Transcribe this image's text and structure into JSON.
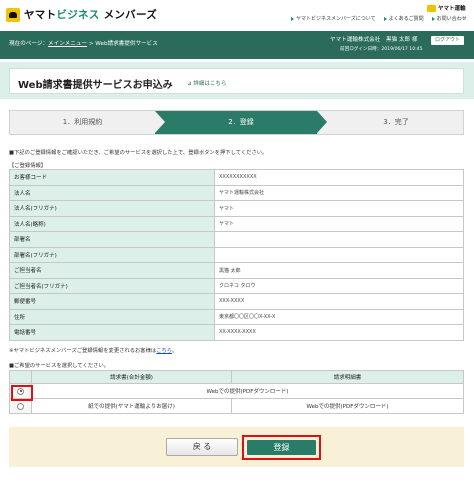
{
  "header": {
    "logo_text_1": "ヤマト",
    "logo_text_accent": "ビジネス",
    "logo_text_2": "メンバーズ",
    "links": [
      {
        "label": "ヤマトビジネスメンバーズについて"
      },
      {
        "label": "よくあるご質問"
      },
      {
        "label": "お問い合わせ"
      }
    ],
    "brand_badge": "ヤマト運輸"
  },
  "nav": {
    "breadcrumb_prefix": "現在のページ：",
    "breadcrumb_link": "メインメニュー",
    "breadcrumb_sep": " > ",
    "breadcrumb_current": "Web請求書提供サービス",
    "company": "ヤマト運輸株式会社",
    "user": "黒猫 太郎 様",
    "last_login": "前回ログイン日時：2019/06/17 10:45",
    "logout_label": "ログアウト"
  },
  "page": {
    "title": "Web請求書提供サービスお申込み",
    "detail_link": "詳細はこちら"
  },
  "steps": [
    {
      "label": "1．利用規約"
    },
    {
      "label": "2．登録"
    },
    {
      "label": "3．完了"
    }
  ],
  "notice": "■下記のご登録情報をご確認いただき、ご希望のサービスを選択した上で、登録ボタンを押下してください。",
  "section_label": "【ご登録情報】",
  "info_rows": [
    {
      "label": "お客様コード",
      "value": "XXXXXXXXXXX"
    },
    {
      "label": "法人名",
      "value": "ヤマト運輸株式会社"
    },
    {
      "label": "法人名(フリガナ)",
      "value": "ヤマト"
    },
    {
      "label": "法人名(略称)",
      "value": "ヤマト"
    },
    {
      "label": "部署名",
      "value": ""
    },
    {
      "label": "部署名(フリガナ)",
      "value": ""
    },
    {
      "label": "ご担当者名",
      "value": "黒猫 太郎"
    },
    {
      "label": "ご担当者名(フリガナ)",
      "value": "クロネコ タロウ"
    },
    {
      "label": "郵便番号",
      "value": "XXX-XXXX"
    },
    {
      "label": "住所",
      "value": "東京都〇〇区〇〇X-XX-X"
    },
    {
      "label": "電話番号",
      "value": "XX-XXXX-XXXX"
    }
  ],
  "change_text": "※ヤマトビジネスメンバーズご登録情報を変更されるお客様は",
  "change_link": "こちら",
  "change_suffix": "。",
  "select_label": "■ご希望のサービスを選択してください。",
  "service_table": {
    "col1": "請求書(合計金額)",
    "col2": "請求明細書",
    "options": [
      {
        "selected": true,
        "col1": "Webでの提供(PDFダウンロード)",
        "col2": ""
      },
      {
        "selected": false,
        "col1": "紙での提供(ヤマト運輸よりお届け)",
        "col2": "Webでの提供(PDFダウンロード)"
      }
    ]
  },
  "buttons": {
    "back": "戻 る",
    "register": "登録"
  }
}
